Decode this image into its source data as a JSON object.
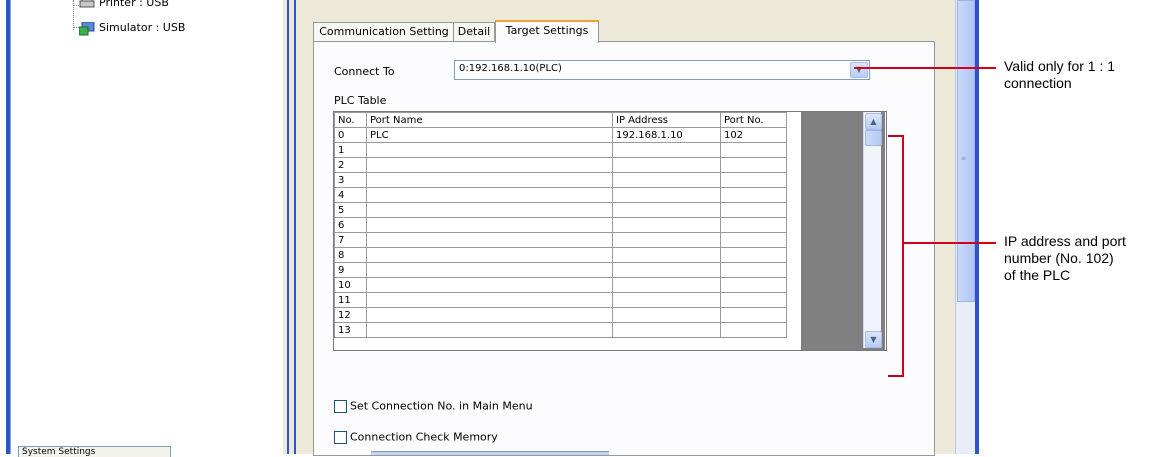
{
  "tree": {
    "items": [
      {
        "label": "Printer : USB",
        "icon": "printer-icon"
      },
      {
        "label": "Simulator : USB",
        "icon": "simulator-icon"
      }
    ],
    "bottom_tab": "System Settings"
  },
  "tabs": [
    {
      "label": "Communication Setting",
      "active": false
    },
    {
      "label": "Detail",
      "active": false
    },
    {
      "label": "Target Settings",
      "active": true
    }
  ],
  "connect_to": {
    "label": "Connect To",
    "value": "0:192.168.1.10(PLC)"
  },
  "plc_table": {
    "label": "PLC Table",
    "columns": [
      "No.",
      "Port Name",
      "IP Address",
      "Port No."
    ],
    "rows": [
      [
        "0",
        "PLC",
        "192.168.1.10",
        "102"
      ],
      [
        "1",
        "",
        "",
        ""
      ],
      [
        "2",
        "",
        "",
        ""
      ],
      [
        "3",
        "",
        "",
        ""
      ],
      [
        "4",
        "",
        "",
        ""
      ],
      [
        "5",
        "",
        "",
        ""
      ],
      [
        "6",
        "",
        "",
        ""
      ],
      [
        "7",
        "",
        "",
        ""
      ],
      [
        "8",
        "",
        "",
        ""
      ],
      [
        "9",
        "",
        "",
        ""
      ],
      [
        "10",
        "",
        "",
        ""
      ],
      [
        "11",
        "",
        "",
        ""
      ],
      [
        "12",
        "",
        "",
        ""
      ],
      [
        "13",
        "",
        "",
        ""
      ]
    ]
  },
  "checkboxes": [
    {
      "label": "Set Connection No. in Main Menu",
      "checked": false
    },
    {
      "label": "Connection Check Memory",
      "checked": false
    }
  ],
  "callouts": {
    "connect": [
      "Valid only for 1 : 1",
      "connection"
    ],
    "table": [
      "IP address and port",
      "number (No. 102)",
      "of the PLC"
    ]
  },
  "colors": {
    "callout": "#d0021b",
    "active_tab_accent": "#f0a030",
    "window_border": "#2b55c8"
  }
}
